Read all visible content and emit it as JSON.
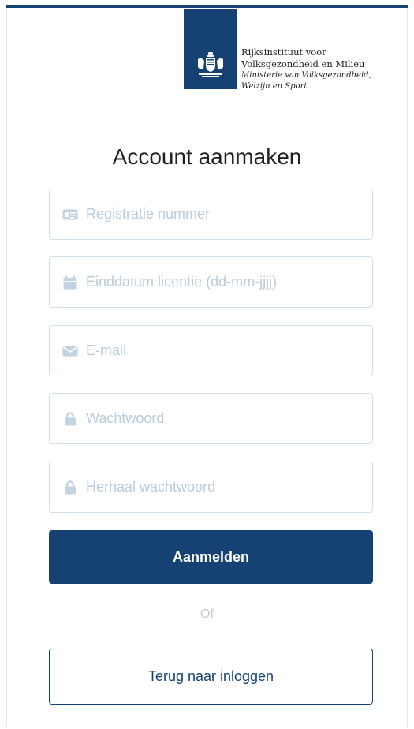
{
  "header": {
    "org_line1": "Rijksinstituut voor",
    "org_line2": "Volksgezondheid en Milieu",
    "ministry_line1": "Ministerie van Volksgezondheid,",
    "ministry_line2": "Welzijn en Sport"
  },
  "form": {
    "title": "Account aanmaken",
    "fields": [
      {
        "icon": "id-card-icon",
        "placeholder": "Registratie nummer",
        "value": ""
      },
      {
        "icon": "calendar-icon",
        "placeholder": "Einddatum licentie (dd-mm-jjjj)",
        "value": ""
      },
      {
        "icon": "envelope-icon",
        "placeholder": "E-mail",
        "value": ""
      },
      {
        "icon": "lock-icon",
        "placeholder": "Wachtwoord",
        "value": ""
      },
      {
        "icon": "lock-icon",
        "placeholder": "Herhaal wachtwoord",
        "value": ""
      }
    ],
    "submit_label": "Aanmelden",
    "or_label": "Of",
    "back_label": "Terug naar inloggen"
  },
  "colors": {
    "brand": "#154273",
    "field_border": "#cfe0ee",
    "placeholder": "#b9ccdb",
    "icon": "#c2d3e1"
  }
}
